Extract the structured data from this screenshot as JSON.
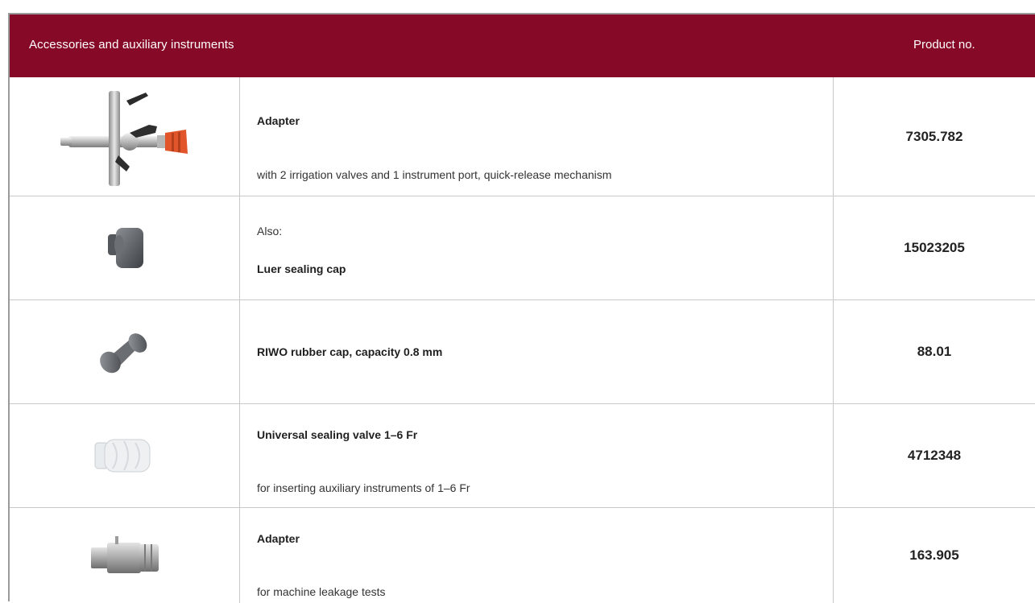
{
  "header": {
    "title": "Accessories and auxiliary instruments",
    "product_no_label": "Product no."
  },
  "rows": [
    {
      "image_icon": "adapter-valves-icon",
      "line1": "Adapter",
      "line2": "with 2 irrigation valves and 1 instrument port, quick-release mechanism",
      "product_no": "7305.782"
    },
    {
      "image_icon": "luer-cap-icon",
      "line1": "Also:",
      "line2": "Luer sealing cap",
      "product_no": "15023205"
    },
    {
      "image_icon": "rubber-cap-icon",
      "line1": "RIWO rubber cap, capacity 0.8 mm",
      "product_no": "88.01"
    },
    {
      "image_icon": "sealing-valve-icon",
      "line1": "Universal sealing valve 1–6 Fr",
      "line2": "for inserting auxiliary instruments of 1–6 Fr",
      "product_no": "4712348"
    },
    {
      "image_icon": "leak-test-adapter-icon",
      "line1": "Adapter",
      "line2": "for machine leakage tests",
      "product_no": "163.905"
    }
  ],
  "colors": {
    "header_bg": "#860a27",
    "header_text": "#ffffff"
  }
}
